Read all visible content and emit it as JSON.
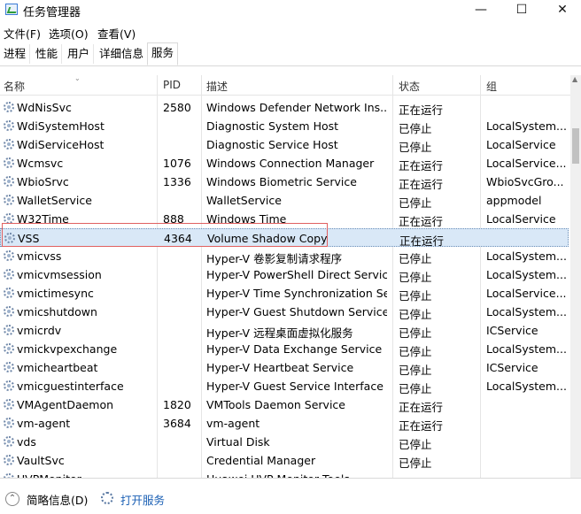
{
  "window": {
    "title": "任务管理器",
    "controls": {
      "minimize": "—",
      "maximize": "☐",
      "close": "✕"
    }
  },
  "menu": [
    "文件(F)",
    "选项(O)",
    "查看(V)"
  ],
  "tabs": [
    {
      "label": "进程",
      "active": false
    },
    {
      "label": "性能",
      "active": false
    },
    {
      "label": "用户",
      "active": false
    },
    {
      "label": "详细信息",
      "active": false
    },
    {
      "label": "服务",
      "active": true
    }
  ],
  "columns": {
    "name": "名称",
    "pid": "PID",
    "desc": "描述",
    "status": "状态",
    "group": "组"
  },
  "rows": [
    {
      "name": "WdNisSvc",
      "pid": "2580",
      "desc": "Windows Defender Network Ins...",
      "status": "正在运行",
      "group": ""
    },
    {
      "name": "WdiSystemHost",
      "pid": "",
      "desc": "Diagnostic System Host",
      "status": "已停止",
      "group": "LocalSystem..."
    },
    {
      "name": "WdiServiceHost",
      "pid": "",
      "desc": "Diagnostic Service Host",
      "status": "已停止",
      "group": "LocalService"
    },
    {
      "name": "Wcmsvc",
      "pid": "1076",
      "desc": "Windows Connection Manager",
      "status": "正在运行",
      "group": "LocalService..."
    },
    {
      "name": "WbioSrvc",
      "pid": "1336",
      "desc": "Windows Biometric Service",
      "status": "正在运行",
      "group": "WbioSvcGro..."
    },
    {
      "name": "WalletService",
      "pid": "",
      "desc": "WalletService",
      "status": "已停止",
      "group": "appmodel"
    },
    {
      "name": "W32Time",
      "pid": "888",
      "desc": "Windows Time",
      "status": "正在运行",
      "group": "LocalService"
    },
    {
      "name": "VSS",
      "pid": "4364",
      "desc": "Volume Shadow Copy",
      "status": "正在运行",
      "group": "",
      "selected": true
    },
    {
      "name": "vmicvss",
      "pid": "",
      "desc": "Hyper-V 卷影复制请求程序",
      "status": "已停止",
      "group": "LocalSystem..."
    },
    {
      "name": "vmicvmsession",
      "pid": "",
      "desc": "Hyper-V PowerShell Direct Service",
      "status": "已停止",
      "group": "LocalSystem..."
    },
    {
      "name": "vmictimesync",
      "pid": "",
      "desc": "Hyper-V Time Synchronization Se...",
      "status": "已停止",
      "group": "LocalService..."
    },
    {
      "name": "vmicshutdown",
      "pid": "",
      "desc": "Hyper-V Guest Shutdown Service",
      "status": "已停止",
      "group": "LocalSystem..."
    },
    {
      "name": "vmicrdv",
      "pid": "",
      "desc": "Hyper-V 远程桌面虚拟化服务",
      "status": "已停止",
      "group": "ICService"
    },
    {
      "name": "vmickvpexchange",
      "pid": "",
      "desc": "Hyper-V Data Exchange Service",
      "status": "已停止",
      "group": "LocalSystem..."
    },
    {
      "name": "vmicheartbeat",
      "pid": "",
      "desc": "Hyper-V Heartbeat Service",
      "status": "已停止",
      "group": "ICService"
    },
    {
      "name": "vmicguestinterface",
      "pid": "",
      "desc": "Hyper-V Guest Service Interface",
      "status": "已停止",
      "group": "LocalSystem..."
    },
    {
      "name": "VMAgentDaemon",
      "pid": "1820",
      "desc": "VMTools Daemon Service",
      "status": "正在运行",
      "group": ""
    },
    {
      "name": "vm-agent",
      "pid": "3684",
      "desc": "vm-agent",
      "status": "正在运行",
      "group": ""
    },
    {
      "name": "vds",
      "pid": "",
      "desc": "Virtual Disk",
      "status": "已停止",
      "group": ""
    },
    {
      "name": "VaultSvc",
      "pid": "",
      "desc": "Credential Manager",
      "status": "已停止",
      "group": ""
    },
    {
      "name": "UVPMonitor",
      "pid": "",
      "desc": "Huawei UVP Monitor Tools",
      "status": "",
      "group": ""
    }
  ],
  "footer": {
    "brief": "简略信息(D)",
    "open_services": "打开服务"
  }
}
